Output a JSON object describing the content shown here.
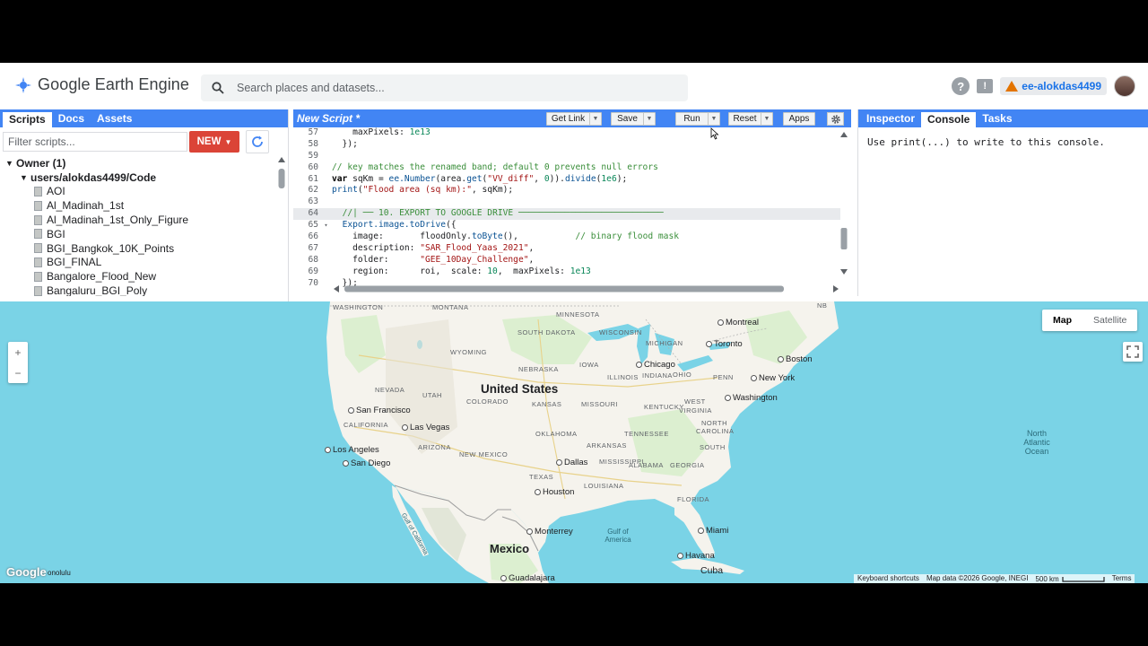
{
  "header": {
    "app_title": "Google Earth Engine",
    "search_placeholder": "Search places and datasets...",
    "user": "ee-alokdas4499",
    "help_glyph": "?",
    "feedback_glyph": "!"
  },
  "left_panel": {
    "tabs": [
      "Scripts",
      "Docs",
      "Assets"
    ],
    "filter_placeholder": "Filter scripts...",
    "new_label": "NEW",
    "tree": [
      {
        "label": "Owner (1)",
        "kind": "root"
      },
      {
        "label": "users/alokdas4499/Code",
        "kind": "folder"
      },
      {
        "label": "AOI",
        "kind": "file"
      },
      {
        "label": "Al_Madinah_1st",
        "kind": "file"
      },
      {
        "label": "Al_Madinah_1st_Only_Figure",
        "kind": "file"
      },
      {
        "label": "BGI",
        "kind": "file"
      },
      {
        "label": "BGI_Bangkok_10K_Points",
        "kind": "file"
      },
      {
        "label": "BGI_FINAL",
        "kind": "file"
      },
      {
        "label": "Bangalore_Flood_New",
        "kind": "file"
      },
      {
        "label": "Bangaluru_BGI_Poly",
        "kind": "file"
      }
    ]
  },
  "editor": {
    "title": "New Script *",
    "buttons": {
      "get_link": "Get Link",
      "save": "Save",
      "run": "Run",
      "reset": "Reset",
      "apps": "Apps"
    },
    "lines": [
      {
        "n": "57",
        "fold": "",
        "html": "    maxPixels: <span class='num'>1e13</span>"
      },
      {
        "n": "58",
        "fold": "",
        "html": "  });"
      },
      {
        "n": "59",
        "fold": "",
        "html": ""
      },
      {
        "n": "60",
        "fold": "",
        "html": "<span class='cmt'>// key matches the renamed band; default 0 prevents null errors</span>"
      },
      {
        "n": "61",
        "fold": "",
        "html": "<span class='kw'>var</span> sqKm = <span class='fn'>ee.Number</span>(area.<span class='fn'>get</span>(<span class='str'>\"VV_diff\"</span>, <span class='num'>0</span>)).<span class='fn'>divide</span>(<span class='num'>1e6</span>);"
      },
      {
        "n": "62",
        "fold": "",
        "html": "<span class='fn'>print</span>(<span class='str'>\"Flood area (sq km):\"</span>, sqKm);"
      },
      {
        "n": "63",
        "fold": "",
        "html": ""
      },
      {
        "n": "64",
        "fold": "",
        "html": "  <span class='cmt'>//| ── 10. EXPORT TO GOOGLE DRIVE ────────────────────────────</span>",
        "current": true
      },
      {
        "n": "65",
        "fold": "▾",
        "html": "  <span class='fn'>Export.image.toDrive</span>({"
      },
      {
        "n": "66",
        "fold": "",
        "html": "    image:       floodOnly.<span class='fn'>toByte</span>(),           <span class='cmt'>// binary flood mask</span>"
      },
      {
        "n": "67",
        "fold": "",
        "html": "    description: <span class='str'>\"SAR_Flood_Yaas_2021\"</span>,"
      },
      {
        "n": "68",
        "fold": "",
        "html": "    folder:      <span class='str'>\"GEE_10Day_Challenge\"</span>,"
      },
      {
        "n": "69",
        "fold": "",
        "html": "    region:      roi,  scale: <span class='num'>10</span>,  maxPixels: <span class='num'>1e13</span>"
      },
      {
        "n": "70",
        "fold": "",
        "html": "  });"
      }
    ]
  },
  "right_panel": {
    "tabs": [
      "Inspector",
      "Console",
      "Tasks"
    ],
    "active_tab": "Console",
    "console_hint": "Use print(...) to write to this console."
  },
  "map": {
    "map_types": [
      "Map",
      "Satellite"
    ],
    "active_map_type": "Map",
    "zoom_in": "+",
    "zoom_out": "−",
    "country_labels": [
      "United States",
      "Mexico",
      "Cuba"
    ],
    "ocean_label": [
      "North",
      "Atlantic",
      "Ocean"
    ],
    "gulf_label": [
      "Gulf of",
      "America"
    ],
    "gulf_cal": "Gulf of California",
    "state_labels": [
      "WASHINGTON",
      "MONTANA",
      "MINNESOTA",
      "SOUTH DAKOTA",
      "WISCONSIN",
      "MICHIGAN",
      "WYOMING",
      "NEBRASKA",
      "IOWA",
      "ILLINOIS",
      "INDIANA",
      "OHIO",
      "PENN",
      "NEVADA",
      "UTAH",
      "COLORADO",
      "KANSAS",
      "MISSOURI",
      "KENTUCKY",
      "WEST",
      "VIRGINIA",
      "CALIFORNIA",
      "ARIZONA",
      "NEW MEXICO",
      "OKLAHOMA",
      "TENNESSEE",
      "ARKANSAS",
      "NORTH",
      "CAROLINA",
      "SOUTH",
      "TEXAS",
      "MISSISSIPPI",
      "ALABAMA",
      "GEORGIA",
      "LOUISIANA",
      "FLORIDA",
      "NB"
    ],
    "cities": [
      "San Francisco",
      "Las Vegas",
      "Los Angeles",
      "San Diego",
      "Dallas",
      "Houston",
      "Monterrey",
      "Chicago",
      "Toronto",
      "Montreal",
      "Boston",
      "New York",
      "Washington",
      "Miami",
      "Havana",
      "Guadalajara"
    ],
    "google_logo": "Google",
    "honolulu_fragment": "onolulu",
    "attribution": [
      "Keyboard shortcuts",
      "Map data ©2026 Google, INEGI",
      "500 km",
      "Terms"
    ],
    "colors": {
      "water": "#7ad3e6",
      "land": "#f5f3ed",
      "land_green": "#d9ecc9",
      "accent": "#4285f4"
    }
  }
}
